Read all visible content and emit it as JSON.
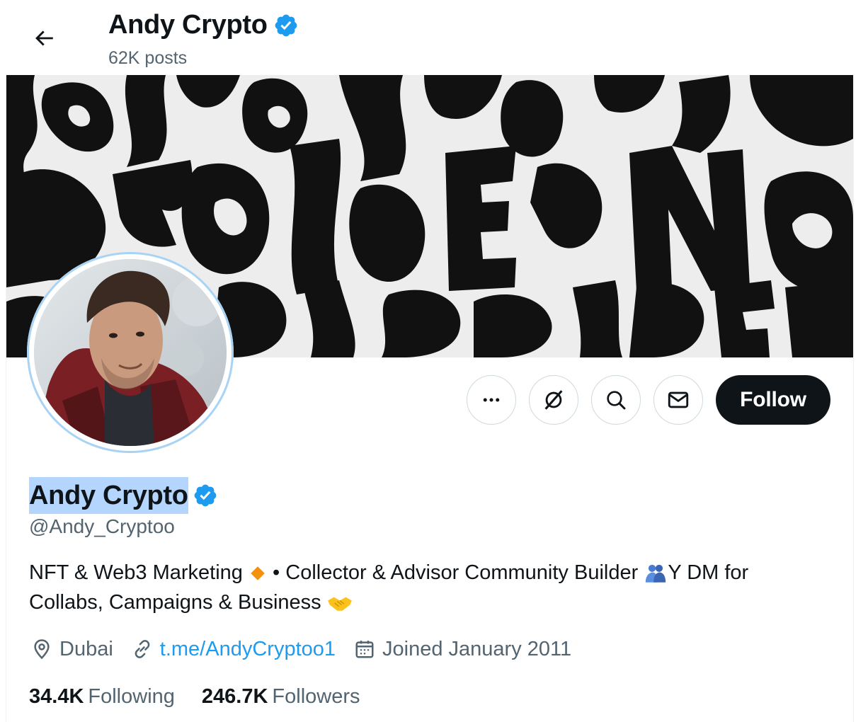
{
  "header": {
    "name": "Andy Crypto",
    "posts_count": "62K posts"
  },
  "profile": {
    "name": "Andy Crypto",
    "handle": "@Andy_Cryptoo",
    "bio_line1_a": "NFT & Web3 Marketing ",
    "bio_line1_b": " • Collector & Advisor Community Builder ",
    "bio_line1_c": "Y DM for",
    "bio_line2": "Collabs, Campaigns & Business ",
    "location": "Dubai",
    "website": "t.me/AndyCryptoo1",
    "joined": "Joined January 2011",
    "following_count": "34.4K",
    "following_label": "Following",
    "followers_count": "246.7K",
    "followers_label": "Followers"
  },
  "actions": {
    "follow_label": "Follow",
    "icons": [
      "more-icon",
      "grok-icon",
      "search-icon",
      "message-icon"
    ]
  },
  "colors": {
    "verified": "#1d9bf0",
    "link": "#1d9bf0",
    "follow_bg": "#0f1419",
    "selection": "#b4d5fe"
  }
}
